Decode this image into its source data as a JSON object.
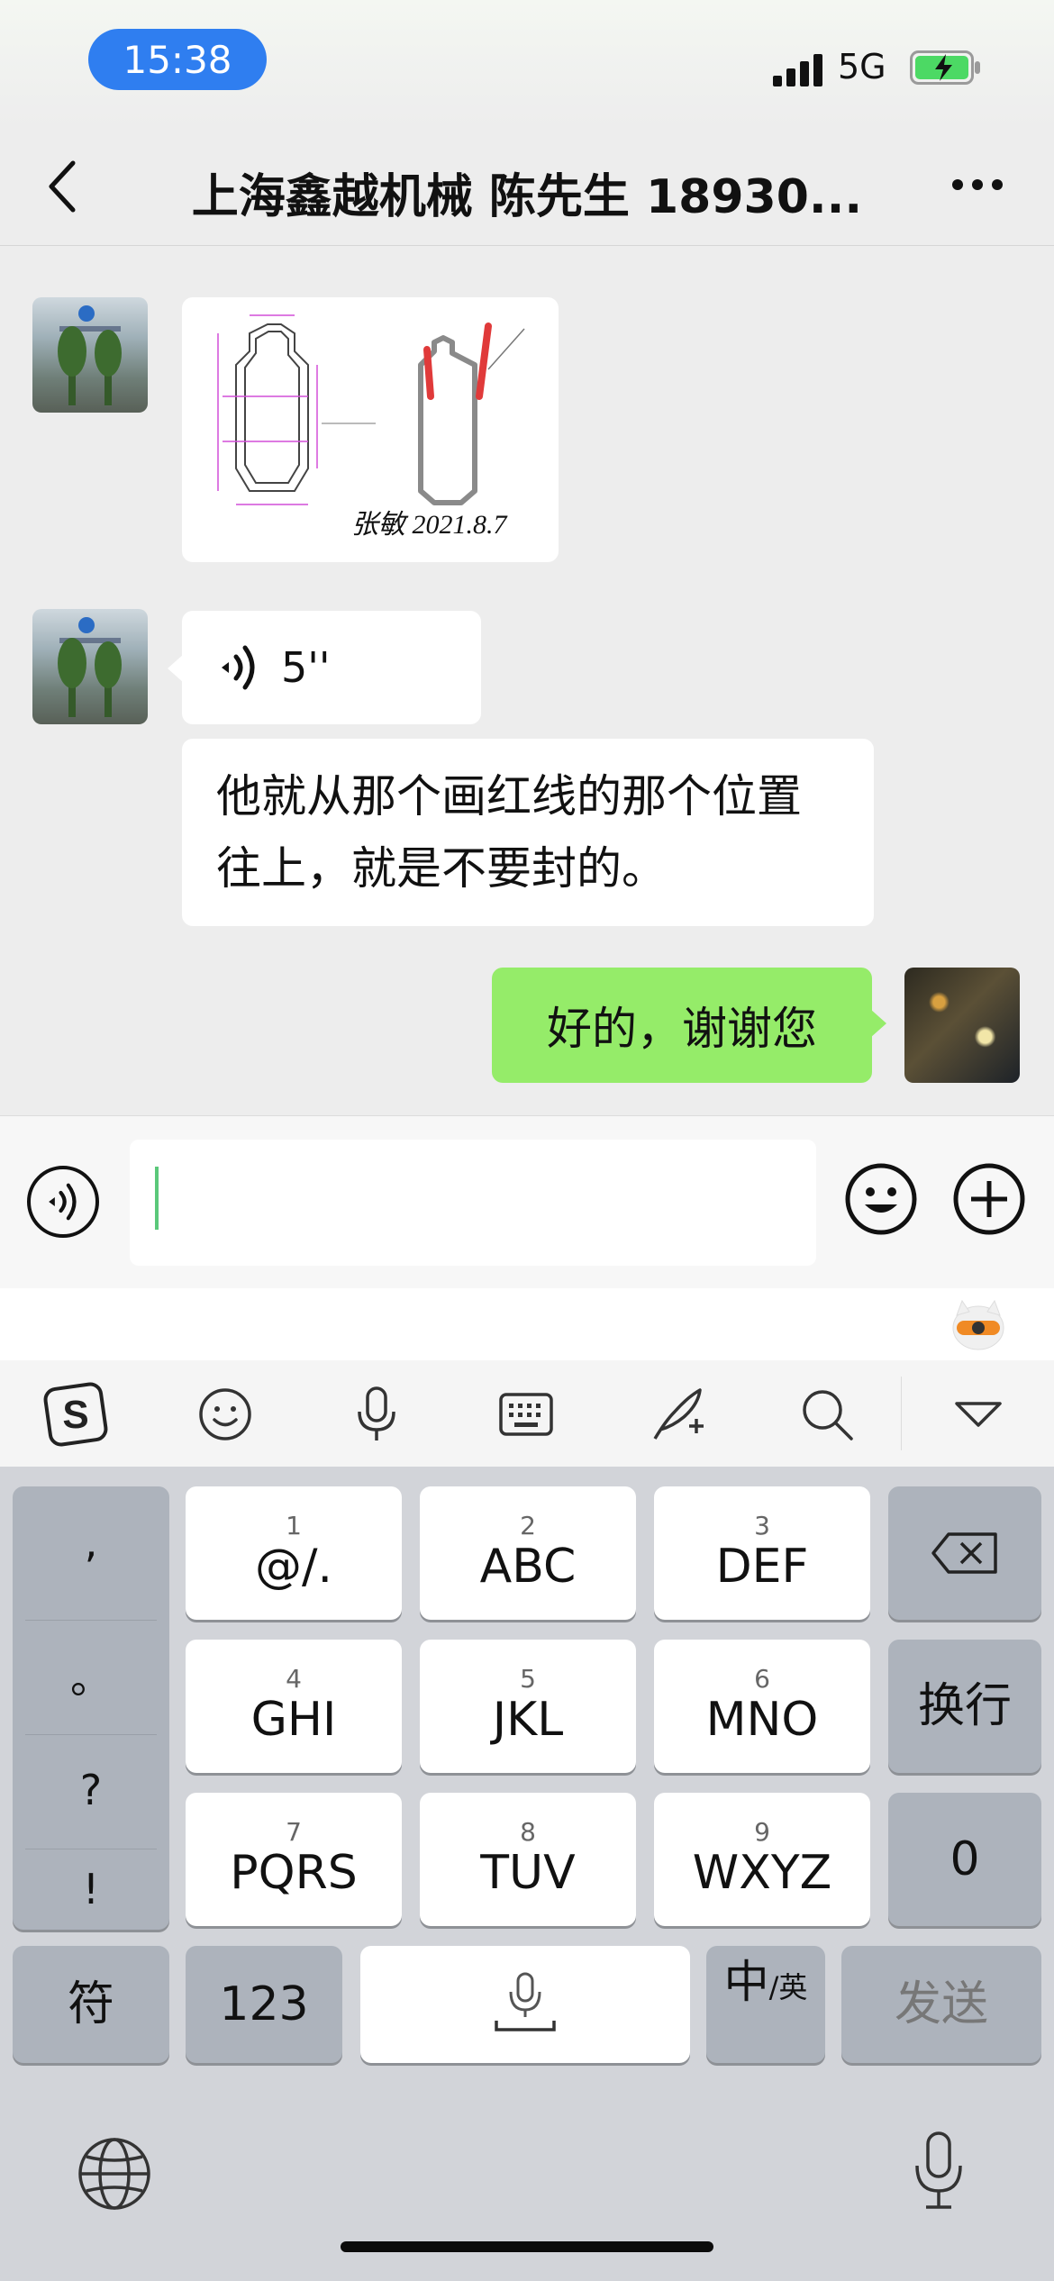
{
  "status_bar": {
    "time": "15:38",
    "network": "5G"
  },
  "nav": {
    "title": "上海鑫越机械 陈先生 18930..."
  },
  "messages": {
    "image_annotation": "张敏 2021.8.7",
    "voice_duration": "5''",
    "text_incoming": "他就从那个画红线的那个位置往上，就是不要封的。",
    "text_outgoing": "好的，谢谢您"
  },
  "input": {
    "placeholder": ""
  },
  "keyboard": {
    "punctuation": [
      ",",
      "。",
      "?",
      "!"
    ],
    "keys": [
      {
        "num": "1",
        "label": "@/."
      },
      {
        "num": "2",
        "label": "ABC"
      },
      {
        "num": "3",
        "label": "DEF"
      },
      {
        "num": "4",
        "label": "GHI"
      },
      {
        "num": "5",
        "label": "JKL"
      },
      {
        "num": "6",
        "label": "MNO"
      },
      {
        "num": "7",
        "label": "PQRS"
      },
      {
        "num": "8",
        "label": "TUV"
      },
      {
        "num": "9",
        "label": "WXYZ"
      }
    ],
    "newline": "换行",
    "zero": "0",
    "symbols": "符",
    "numbers": "123",
    "lang_main": "中",
    "lang_sub": "/英",
    "send": "发送"
  },
  "colors": {
    "accent_blue": "#2f7ef0",
    "bubble_green": "#95ec69",
    "chat_bg": "#ededed",
    "keyboard_bg": "#d2d4d9"
  },
  "icons": [
    "back-icon",
    "more-icon",
    "voice-wave-icon",
    "emoji-icon",
    "plus-icon",
    "sogou-logo-icon",
    "smiley-icon",
    "microphone-icon",
    "keyboard-icon",
    "handwriting-icon",
    "search-icon",
    "collapse-icon",
    "backspace-icon",
    "space-mic-icon",
    "globe-icon",
    "dictation-mic-icon"
  ]
}
